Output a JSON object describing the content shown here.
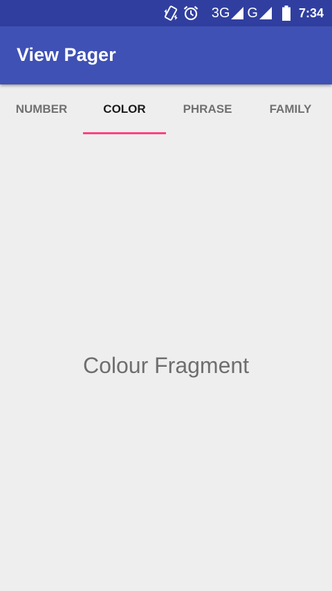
{
  "status_bar": {
    "network_1": "3G",
    "network_2": "G",
    "time": "7:34",
    "icons": [
      "vibrate-icon",
      "alarm-icon",
      "signal-icon",
      "signal-icon",
      "battery-icon"
    ]
  },
  "app_bar": {
    "title": "View Pager"
  },
  "tabs": [
    {
      "label": "NUMBER"
    },
    {
      "label": "COLOR"
    },
    {
      "label": "PHRASE"
    },
    {
      "label": "FAMILY"
    }
  ],
  "active_tab": "COLOR",
  "content": {
    "text": "Colour Fragment"
  },
  "colors": {
    "status_bar": "#303f9f",
    "primary": "#3f51b5",
    "accent": "#ff4081",
    "background": "#eeeeee"
  }
}
